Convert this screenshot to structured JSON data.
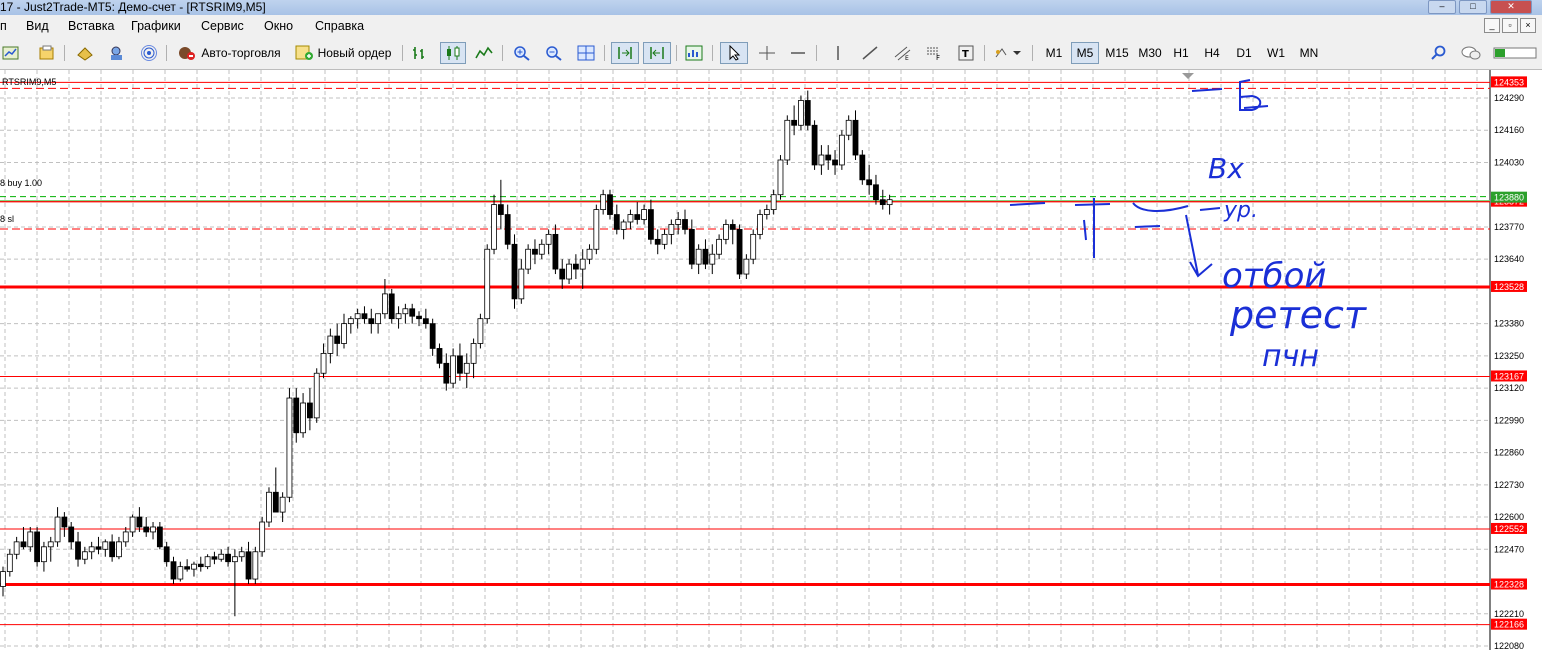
{
  "window": {
    "title": "17 - Just2Trade-MT5: Демо-счет - [RTSRIM9,M5]",
    "controls": [
      "–",
      "□",
      "✕"
    ]
  },
  "menu": {
    "items": [
      "п",
      "Вид",
      "Вставка",
      "Графики",
      "Сервис",
      "Окно",
      "Справка"
    ],
    "mdi_controls": [
      "_",
      "▫",
      "×"
    ]
  },
  "toolbar": {
    "autotrade_label": "Авто-торговля",
    "new_order_label": "Новый ордер",
    "timeframes": [
      "M1",
      "M5",
      "M15",
      "M30",
      "H1",
      "H4",
      "D1",
      "W1",
      "MN"
    ],
    "active_timeframe": "M5"
  },
  "chart": {
    "symbol_label": "RTSRIM9,M5",
    "order_buy_label": "8 buy 1.00",
    "order_sl_label": "8 sl",
    "price_ticks": [
      "124290",
      "124160",
      "124030",
      "123770",
      "123640",
      "123380",
      "123250",
      "123120",
      "122990",
      "122860",
      "122730",
      "122600",
      "122470",
      "122210",
      "122080"
    ],
    "level_tags": [
      "124353",
      "123872",
      "123528",
      "123167",
      "122552",
      "122328",
      "122166"
    ],
    "buy_tag": "123880",
    "colors": {
      "bg": "#ffffff",
      "grid": "#c0c0c0",
      "level": "#ff0000",
      "buy_line": "#00b000",
      "candle_bull": "#ffffff",
      "candle_bear": "#000000",
      "handwriting": "#1a2fd6"
    },
    "annotations": [
      "Б",
      "Вх",
      "ур.",
      "отбой",
      "ретест",
      "пчн"
    ]
  }
}
